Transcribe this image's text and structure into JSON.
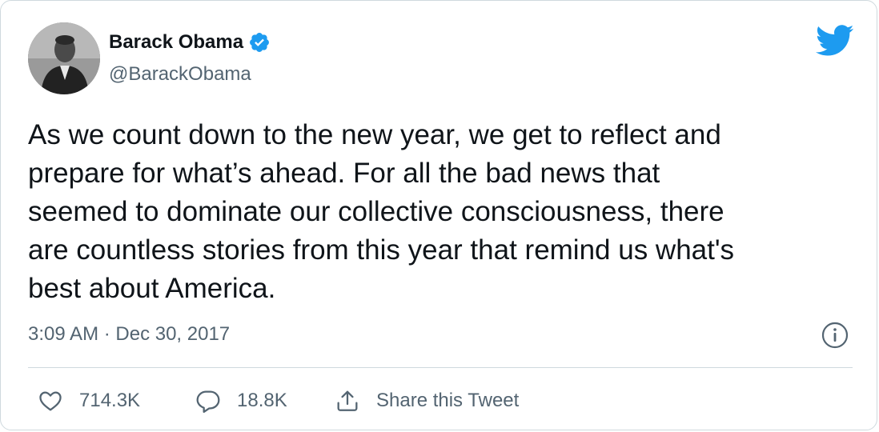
{
  "author": {
    "name": "Barack Obama",
    "handle": "@BarackObama",
    "verified": true,
    "avatar_icon": "avatar-photo"
  },
  "tweet": {
    "text": "As we count down to the new year, we get to reflect and\nprepare for what’s ahead. For all the bad news that\nseemed to dominate our collective consciousness, there\nare countless stories from this year that remind us what's\nbest about America.",
    "timestamp": "3:09 AM · Dec 30, 2017"
  },
  "actions": {
    "likes": "714.3K",
    "replies": "18.8K",
    "share_label": "Share this Tweet"
  },
  "colors": {
    "brand": "#1d9bf0",
    "text": "#0f1419",
    "secondary": "#536471",
    "border": "#cfd9de"
  },
  "icons": [
    "twitter-bird-icon",
    "verified-badge-icon",
    "info-icon",
    "heart-icon",
    "reply-icon",
    "share-icon"
  ]
}
